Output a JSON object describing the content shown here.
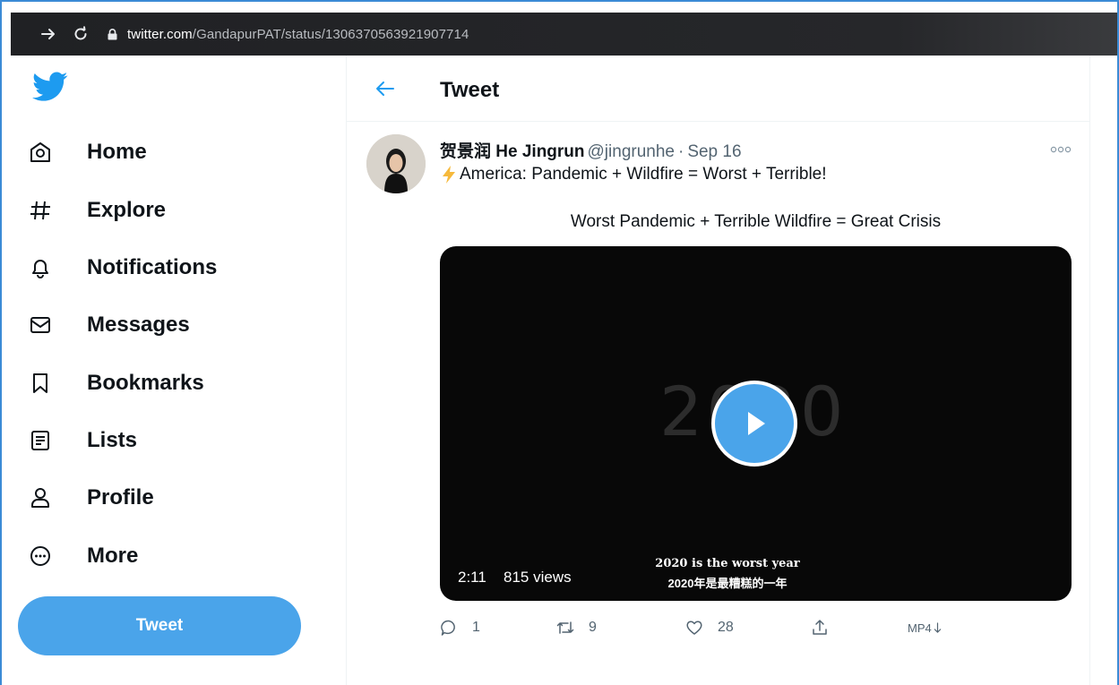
{
  "browser": {
    "url_host": "twitter.com",
    "url_path": "/GandapurPAT/status/1306370563921907714"
  },
  "sidebar": {
    "items": [
      {
        "label": "Home",
        "icon": "home-icon"
      },
      {
        "label": "Explore",
        "icon": "hashtag-icon"
      },
      {
        "label": "Notifications",
        "icon": "bell-icon"
      },
      {
        "label": "Messages",
        "icon": "envelope-icon"
      },
      {
        "label": "Bookmarks",
        "icon": "bookmark-icon"
      },
      {
        "label": "Lists",
        "icon": "list-icon"
      },
      {
        "label": "Profile",
        "icon": "person-icon"
      },
      {
        "label": "More",
        "icon": "more-circle-icon"
      }
    ],
    "tweet_button": "Tweet"
  },
  "header": {
    "title": "Tweet"
  },
  "tweet": {
    "author_name": "贺景润 He Jingrun",
    "handle": "@jingrunhe",
    "separator": "·",
    "date": "Sep 16",
    "text_line1": "America: Pandemic + Wildfire = Worst + Terrible!",
    "text_line2": "Worst Pandemic + Terrible Wildfire = Great Crisis",
    "video": {
      "background_text": "2020",
      "duration": "2:11",
      "views": "815 views",
      "subtitle_en": "2020 is the worst year",
      "subtitle_zh": "2020年是最糟糕的一年"
    },
    "actions": {
      "replies": "1",
      "retweets": "9",
      "likes": "28",
      "download_label": "MP4"
    }
  },
  "colors": {
    "twitter_blue": "#4aa4ea",
    "text_primary": "#0f1419",
    "text_secondary": "#536471",
    "browser_bar": "#202124"
  }
}
